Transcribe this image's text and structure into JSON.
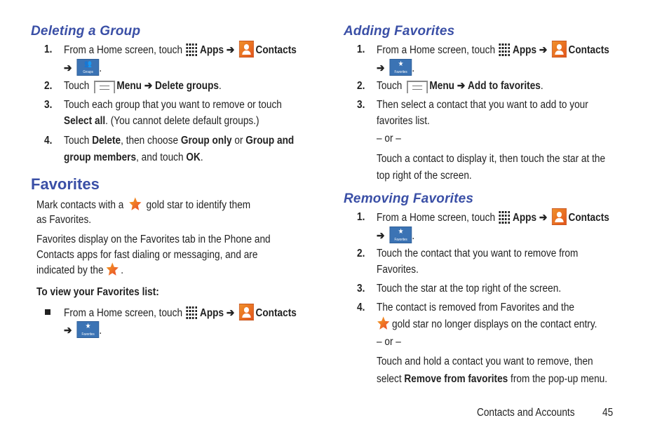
{
  "left": {
    "deleting_group": {
      "heading": "Deleting a Group",
      "steps": [
        {
          "num": "1.",
          "l1_a": "From a Home screen, touch",
          "apps": "Apps",
          "arrow": "➔",
          "contacts": "Contacts",
          "l2_arrow": "➔",
          "tab_label": "Groups",
          "tab_glyph": "👥",
          "period": "."
        },
        {
          "num": "2.",
          "a": "Touch",
          "menu": "Menu",
          "arrow": "➔",
          "b": "Delete groups",
          "period": "."
        },
        {
          "num": "3.",
          "l1": "Touch each group that you want to remove or touch",
          "l2_bold": "Select all",
          "l2_rest": ". (You cannot delete default groups.)"
        },
        {
          "num": "4.",
          "l1_a": "Touch ",
          "l1_b": "Delete",
          "l1_c": ", then choose ",
          "l1_d": "Group only",
          "l1_e": " or ",
          "l1_f": "Group and",
          "l2_a": "group members",
          "l2_b": ", and touch ",
          "l2_c": "OK",
          "l2_d": "."
        }
      ]
    },
    "favorites": {
      "heading": "Favorites",
      "p1_l1_a": "Mark contacts with a",
      "p1_l1_b": "gold star to identify them",
      "p1_l2": "as Favorites.",
      "p2_l1": "Favorites display on the Favorites tab in the Phone and",
      "p2_l2": "Contacts apps for fast dialing or messaging, and are",
      "p2_l3_a": "indicated by the",
      "p2_l3_b": ".",
      "subheading": "To view your Favorites list:",
      "bullet": {
        "l1_a": "From a Home screen, touch",
        "apps": "Apps",
        "arrow": "➔",
        "contacts": "Contacts",
        "l2_arrow": "➔",
        "tab_label": "Favorites",
        "tab_glyph": "★",
        "period": "."
      }
    }
  },
  "right": {
    "adding": {
      "heading": "Adding Favorites",
      "steps": [
        {
          "num": "1.",
          "l1_a": "From a Home screen, touch",
          "apps": "Apps",
          "arrow": "➔",
          "contacts": "Contacts",
          "l2_arrow": "➔",
          "tab_label": "Favorites",
          "tab_glyph": "★",
          "period": "."
        },
        {
          "num": "2.",
          "a": "Touch",
          "menu": "Menu",
          "arrow": "➔",
          "b": "Add to favorites",
          "period": "."
        },
        {
          "num": "3.",
          "l1": "Then select a contact that you want to add to your",
          "l2": "favorites list.",
          "or": "– or –",
          "l3": "Touch a contact to display it, then touch the star at the",
          "l4": "top right of the screen."
        }
      ]
    },
    "removing": {
      "heading": "Removing Favorites",
      "steps": [
        {
          "num": "1.",
          "l1_a": "From a Home screen, touch",
          "apps": "Apps",
          "arrow": "➔",
          "contacts": "Contacts",
          "l2_arrow": "➔",
          "tab_label": "Favorites",
          "tab_glyph": "★",
          "period": "."
        },
        {
          "num": "2.",
          "l1": "Touch the contact that you want to remove from",
          "l2": "Favorites."
        },
        {
          "num": "3.",
          "l1": "Touch the star at the top right of the screen."
        },
        {
          "num": "4.",
          "l1": "The contact is removed from Favorites and the",
          "l2": "gold star no longer displays on the contact entry.",
          "or": "– or –",
          "l3": "Touch and hold a contact you want to remove, then",
          "l4_a": "select ",
          "l4_b": "Remove from favorites",
          "l4_c": " from the pop-up menu."
        }
      ]
    }
  },
  "footer": {
    "section": "Contacts and Accounts",
    "page": "45"
  },
  "colors": {
    "heading": "#3a4fa6",
    "star_start": "#f5a623",
    "star_end": "#e8452a",
    "tab_blue": "#3b73b4",
    "contacts_orange": "#e8702a"
  }
}
